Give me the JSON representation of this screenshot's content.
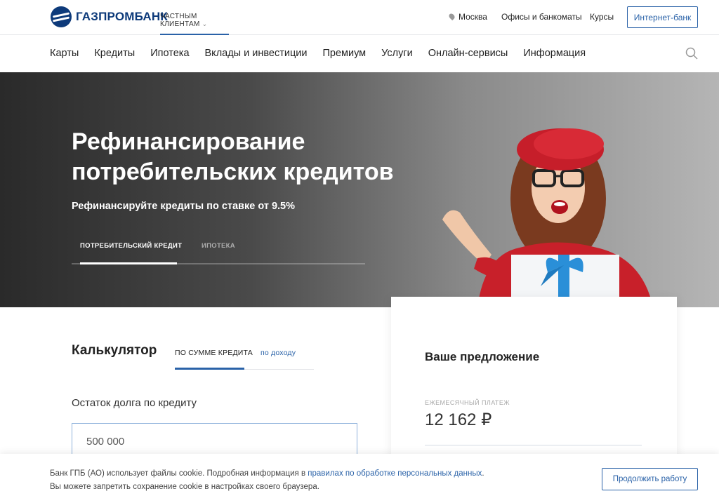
{
  "header": {
    "logo_text": "ГАЗПРОМБАНК",
    "segment": "ЧАСТНЫМ КЛИЕНТАМ",
    "city": "Москва",
    "offices": "Офисы и банкоматы",
    "rates": "Курсы",
    "internet_bank": "Интернет-банк"
  },
  "nav": {
    "items": [
      "Карты",
      "Кредиты",
      "Ипотека",
      "Вклады и инвестиции",
      "Премиум",
      "Услуги",
      "Онлайн-сервисы",
      "Информация"
    ]
  },
  "hero": {
    "title_line1": "Рефинансирование",
    "title_line2": "потребительских кредитов",
    "subtitle": "Рефинансируйте кредиты по ставке от 9.5%",
    "tabs": [
      "ПОТРЕБИТЕЛЬСКИЙ КРЕДИТ",
      "ИПОТЕКА"
    ]
  },
  "calculator": {
    "title": "Калькулятор",
    "tabs": [
      "ПО СУММЕ КРЕДИТА",
      "по доходу"
    ],
    "debt_label": "Остаток долга по кредиту",
    "debt_value": "500 000"
  },
  "offer": {
    "title": "Ваше предложение",
    "payment_label": "ЕЖЕМЕСЯЧНЫЙ ПЛАТЕЖ",
    "payment_value": "12 162 ₽"
  },
  "cookie": {
    "text_before": "Банк ГПБ (АО) использует файлы cookie. Подробная информация в ",
    "link": "правилах по обработке персональных данных",
    "text_after": ".",
    "line2": "Вы можете запретить сохранение cookie в настройках своего браузера.",
    "button": "Продолжить работу"
  },
  "colors": {
    "brand": "#0d3a7a",
    "accent": "#2a62a8"
  }
}
